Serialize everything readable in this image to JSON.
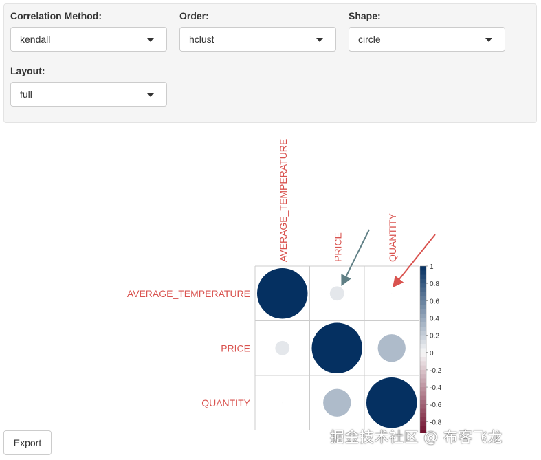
{
  "controls": {
    "method": {
      "label": "Correlation Method:",
      "value": "kendall"
    },
    "order": {
      "label": "Order:",
      "value": "hclust"
    },
    "shape": {
      "label": "Shape:",
      "value": "circle"
    },
    "layout": {
      "label": "Layout:",
      "value": "full"
    }
  },
  "export_label": "Export",
  "watermark": "掘金技术社区 @ 布客飞龙",
  "chart_data": {
    "type": "heatmap",
    "variables": [
      "AVERAGE_TEMPERATURE",
      "PRICE",
      "QUANTITY"
    ],
    "matrix": [
      [
        1,
        0.08,
        0.0
      ],
      [
        0.08,
        1,
        0.3
      ],
      [
        0.0,
        0.3,
        1
      ]
    ],
    "colorbar": {
      "range": [
        -1,
        1
      ],
      "tick_labels": [
        "1",
        "0.8",
        "0.6",
        "0.4",
        "0.2",
        "0",
        "-0.2",
        "-0.4",
        "-0.6",
        "-0.8"
      ]
    },
    "colors": {
      "positive": "#053061",
      "neutral": "#f7f7f7",
      "negative": "#67001f",
      "label": "#d9534f"
    }
  }
}
